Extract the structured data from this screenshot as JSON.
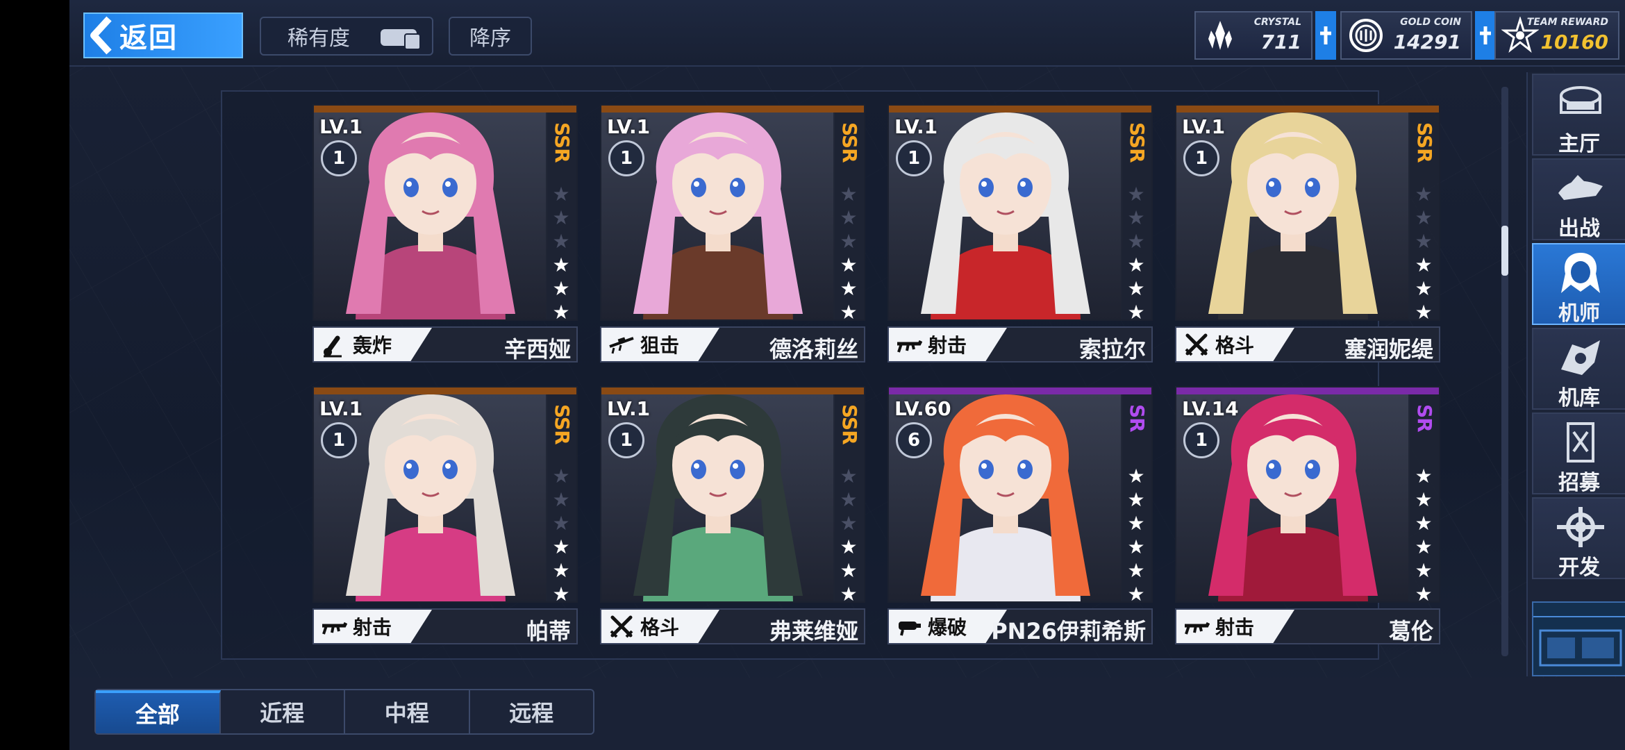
{
  "header": {
    "back_label": "返回",
    "rarity_label": "稀有度",
    "sort_label": "降序"
  },
  "resources": [
    {
      "name": "CRYSTAL",
      "value": "711",
      "icon": "crystal-icon"
    },
    {
      "name": "GOLD COIN",
      "value": "14291",
      "icon": "gold-coin-icon"
    },
    {
      "name": "TEAM REWARD",
      "value": "10160",
      "icon": "team-reward-icon",
      "highlight": "#f2c230"
    }
  ],
  "cards": [
    {
      "lv": "LV.1",
      "rank": "1",
      "rarity": "SSR",
      "stars_filled": 3,
      "stars_total": 6,
      "role": "轰炸",
      "role_icon": "mortar-icon",
      "name": "辛西娅",
      "hair": "#e07ab0",
      "accent": "#b8457a"
    },
    {
      "lv": "LV.1",
      "rank": "1",
      "rarity": "SSR",
      "stars_filled": 3,
      "stars_total": 6,
      "role": "狙击",
      "role_icon": "sniper-rifle-icon",
      "name": "德洛莉丝",
      "hair": "#e8a8d8",
      "accent": "#6a3a2a"
    },
    {
      "lv": "LV.1",
      "rank": "1",
      "rarity": "SSR",
      "stars_filled": 3,
      "stars_total": 6,
      "role": "射击",
      "role_icon": "assault-rifle-icon",
      "name": "索拉尔",
      "hair": "#e8e8e8",
      "accent": "#c8262a"
    },
    {
      "lv": "LV.1",
      "rank": "1",
      "rarity": "SSR",
      "stars_filled": 3,
      "stars_total": 6,
      "role": "格斗",
      "role_icon": "crossed-swords-icon",
      "name": "塞润妮缇",
      "hair": "#e8d49a",
      "accent": "#2a2c34"
    },
    {
      "lv": "LV.1",
      "rank": "1",
      "rarity": "SSR",
      "stars_filled": 3,
      "stars_total": 6,
      "role": "射击",
      "role_icon": "assault-rifle-icon",
      "name": "帕蒂",
      "hair": "#e2dcd6",
      "accent": "#d63c84"
    },
    {
      "lv": "LV.1",
      "rank": "1",
      "rarity": "SSR",
      "stars_filled": 3,
      "stars_total": 6,
      "role": "格斗",
      "role_icon": "crossed-swords-icon",
      "name": "弗莱维娅",
      "hair": "#2e3a3a",
      "accent": "#5aa87c"
    },
    {
      "lv": "LV.60",
      "rank": "6",
      "rarity": "SR",
      "stars_filled": 6,
      "stars_total": 6,
      "role": "爆破",
      "role_icon": "grenade-launcher-icon",
      "name": "PN26伊莉希斯",
      "hair": "#f06a3a",
      "accent": "#e8e8f0"
    },
    {
      "lv": "LV.14",
      "rank": "1",
      "rarity": "SR",
      "stars_filled": 6,
      "stars_total": 6,
      "role": "射击",
      "role_icon": "assault-rifle-icon",
      "name": "葛伦",
      "hair": "#d42c6a",
      "accent": "#a01a3a"
    }
  ],
  "rarity_colors": {
    "SSR": "#f5a623",
    "SR": "#b14cf0"
  },
  "side_nav": [
    {
      "label": "主厅",
      "icon": "main-hall-icon"
    },
    {
      "label": "出战",
      "icon": "sortie-icon"
    },
    {
      "label": "机师",
      "icon": "pilot-icon",
      "active": true
    },
    {
      "label": "机库",
      "icon": "hangar-icon"
    },
    {
      "label": "招募",
      "icon": "recruit-icon"
    },
    {
      "label": "开发",
      "icon": "develop-icon"
    }
  ],
  "tabs": [
    {
      "label": "全部",
      "active": true
    },
    {
      "label": "近程"
    },
    {
      "label": "中程"
    },
    {
      "label": "远程"
    }
  ]
}
